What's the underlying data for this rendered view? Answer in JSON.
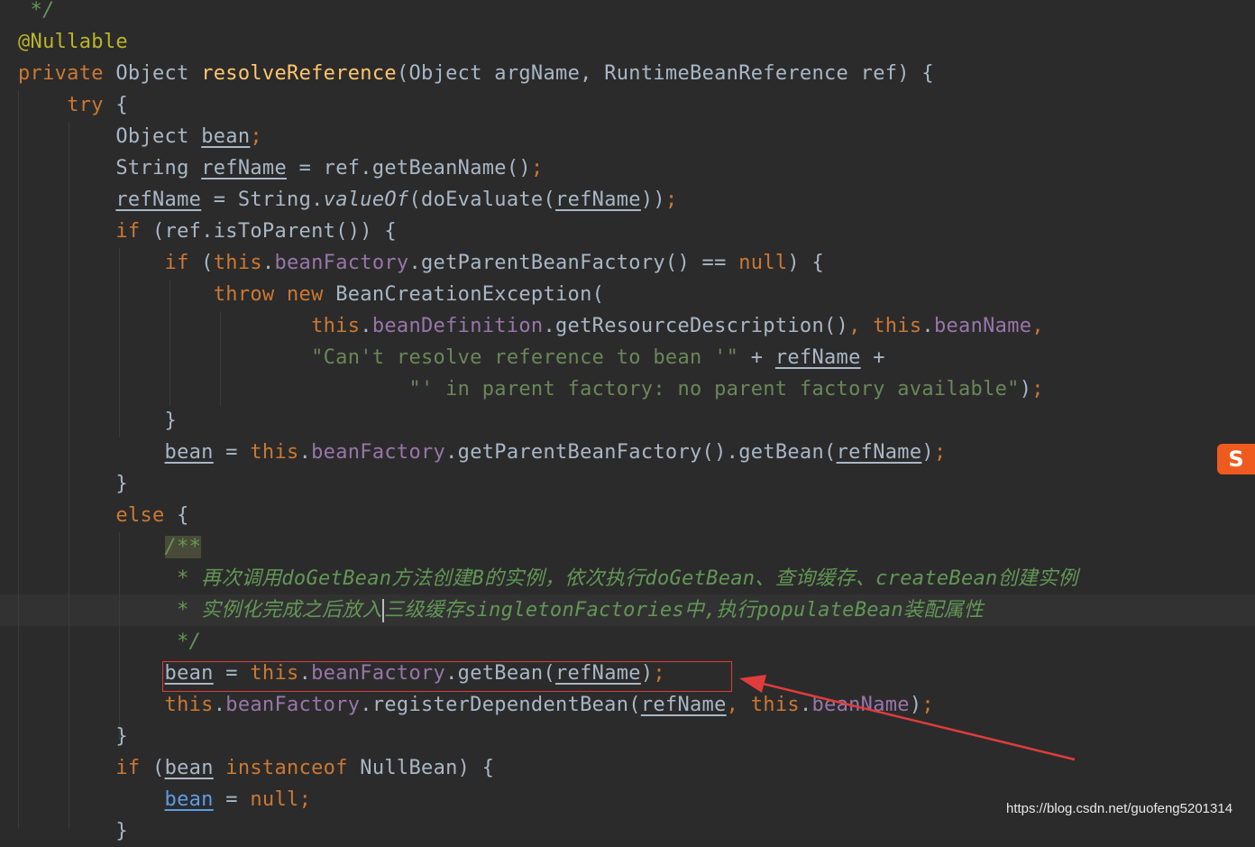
{
  "code": {
    "l0": " */",
    "l1": "@Nullable",
    "l2": {
      "kw": "private",
      "type": " Object ",
      "fn": "resolveReference",
      "sig": "(Object argName, RuntimeBeanReference ref) {"
    },
    "l3": {
      "kw": "try",
      "rest": " {"
    },
    "l4": {
      "type": "Object ",
      "var": "bean",
      "semi": ";"
    },
    "l5": {
      "type": "String ",
      "var": "refName",
      "rest": " = ref.getBeanName()",
      "semi": ";"
    },
    "l6": {
      "var": "refName",
      "a": " = String.",
      "method": "valueOf",
      "b": "(doEvaluate(",
      "var2": "refName",
      "c": "))",
      "semi": ";"
    },
    "l7": {
      "kw": "if",
      "rest": " (ref.isToParent()) {"
    },
    "l8": {
      "kw": "if",
      "a": " (",
      "this": "this",
      "dot": ".",
      "field": "beanFactory",
      "b": ".getParentBeanFactory() == ",
      "null": "null",
      "c": ") {"
    },
    "l9": {
      "kw1": "throw",
      "kw2": "new",
      "rest": " BeanCreationException("
    },
    "l10": {
      "this1": "this",
      "f1": "beanDefinition",
      "a": ".getResourceDescription()",
      "comma": ",",
      "this2": "this",
      "f2": "beanName",
      "comma2": ","
    },
    "l11": {
      "str": "\"Can't resolve reference to bean '\"",
      "a": " + ",
      "var": "refName",
      "b": " +"
    },
    "l12": {
      "str": "\"' in parent factory: no parent factory available\"",
      "a": ")",
      "semi": ";"
    },
    "l13": "}",
    "l14": {
      "var": "bean",
      "a": " = ",
      "this": "this",
      "field": "beanFactory",
      "b": ".getParentBeanFactory().getBean(",
      "var2": "refName",
      "c": ")",
      "semi": ";"
    },
    "l15": "}",
    "l16": {
      "kw": "else",
      "rest": " {"
    },
    "l17": "/**",
    "l18": " * 再次调用doGetBean方法创建B的实例，依次执行doGetBean、查询缓存、createBean创建实例",
    "l19a": " * 实例化完成之后放入",
    "l19b": "三级缓存singletonFactories中,执行populateBean装配属性",
    "l20": " */",
    "l21": {
      "var": "bean",
      "a": " = ",
      "this": "this",
      "field": "beanFactory",
      "b": ".getBean(",
      "var2": "refName",
      "c": ")",
      "semi": ";"
    },
    "l22": {
      "this1": "this",
      "field": "beanFactory",
      "a": ".registerDependentBean(",
      "var": "refName",
      "comma": ",",
      "this2": "this",
      "f2": "beanName",
      "c": ")",
      "semi": ";"
    },
    "l23": "}",
    "l24": {
      "kw": "if",
      "a": " (",
      "var": "bean",
      "kw2": "instanceof",
      "b": " NullBean) {"
    },
    "l25": {
      "var": "bean",
      "a": " = ",
      "null": "null",
      "semi": ";"
    },
    "l26": "}"
  },
  "overlay": {
    "sogou_label": "S",
    "watermark": "https://blog.csdn.net/guofeng5201314"
  },
  "colors": {
    "background": "#2b2b2b",
    "keyword": "#cc7832",
    "function": "#ffc66d",
    "field": "#9876aa",
    "string": "#6a8759",
    "doc_comment": "#629755",
    "annotation_box": "#e03c3c"
  }
}
